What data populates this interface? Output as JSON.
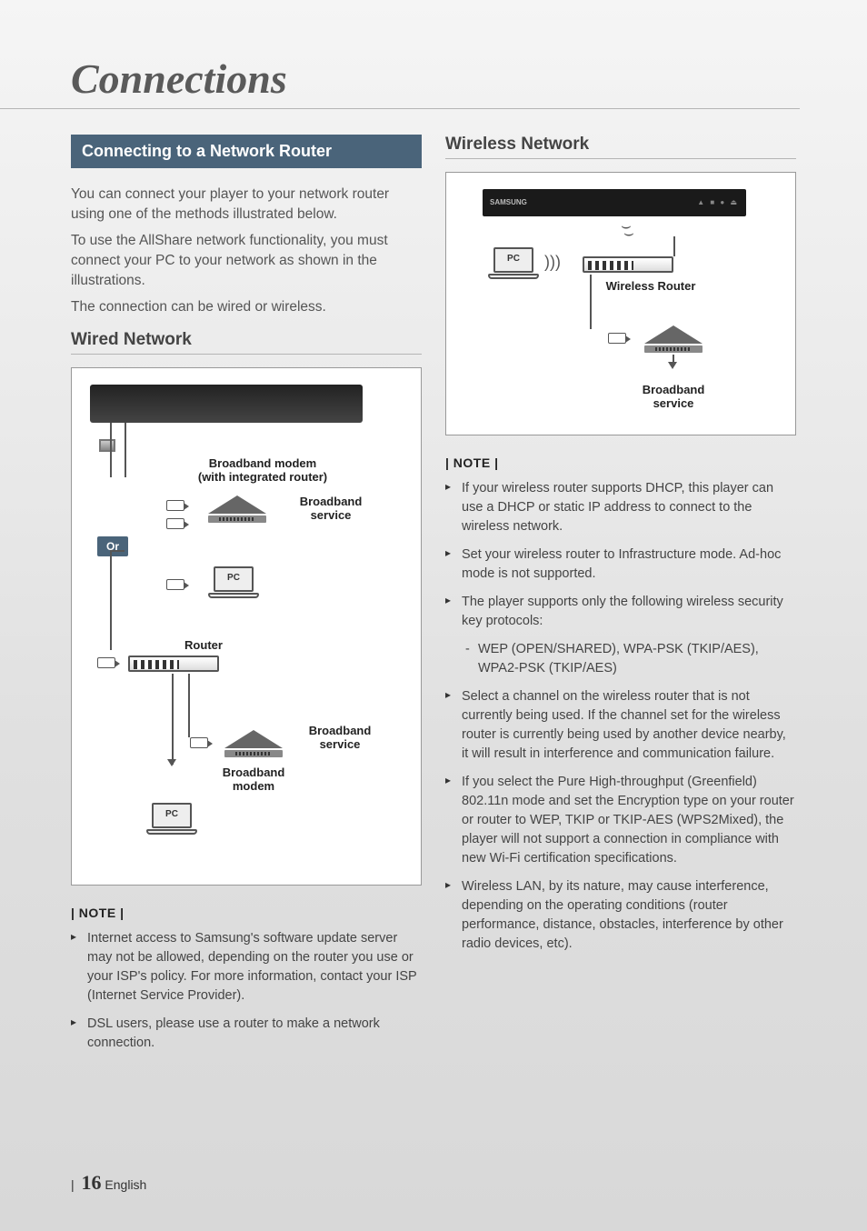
{
  "chapter_title": "Connections",
  "left": {
    "section_header": "Connecting to a Network Router",
    "intro_p1": "You can connect your player to your network router using one of the methods illustrated below.",
    "intro_p2": "To use the AllShare network functionality, you must connect your PC to your network as shown in the illustrations.",
    "intro_p3": "The connection can be wired or wireless.",
    "subheading": "Wired Network",
    "diagram": {
      "or_label": "Or",
      "pc_label": "PC",
      "router_label": "Router",
      "bb_modem_integrated_l1": "Broadband modem",
      "bb_modem_integrated_l2": "(with integrated router)",
      "broadband_service_l1": "Broadband",
      "broadband_service_l2": "service",
      "broadband_modem_l1": "Broadband",
      "broadband_modem_l2": "modem"
    },
    "note_header": "| NOTE |",
    "notes": [
      "Internet access to Samsung's software update server may not be allowed, depending on the router you use or your ISP's policy. For more information, contact your ISP (Internet Service Provider).",
      "DSL users, please use a router to make a network connection."
    ]
  },
  "right": {
    "subheading": "Wireless Network",
    "diagram": {
      "pc_label": "PC",
      "wireless_router_label": "Wireless Router",
      "broadband_service_l1": "Broadband",
      "broadband_service_l2": "service",
      "samsung_brand": "SAMSUNG"
    },
    "note_header": "| NOTE |",
    "notes": [
      "If your wireless router supports DHCP, this player can use a DHCP or static IP address to connect to the wireless network.",
      "Set your wireless router to Infrastructure mode. Ad-hoc mode is not supported.",
      "The player supports only the following wireless security key protocols:",
      "Select a channel on the wireless router that is not currently being used. If the channel set for the wireless router is currently being used by another device nearby, it will result in interference and communication failure.",
      "If you select the Pure High-throughput (Greenfield) 802.11n mode and set the Encryption type on your router or router to WEP, TKIP or TKIP-AES (WPS2Mixed), the player will not support a connection in compliance with new Wi-Fi certification specifications.",
      "Wireless LAN, by its nature, may cause interference, depending on the operating conditions (router performance, distance, obstacles, interference by other radio devices, etc)."
    ],
    "sub_note": "WEP (OPEN/SHARED), WPA-PSK (TKIP/AES), WPA2-PSK (TKIP/AES)"
  },
  "footer": {
    "page_number": "16",
    "language": "English"
  }
}
